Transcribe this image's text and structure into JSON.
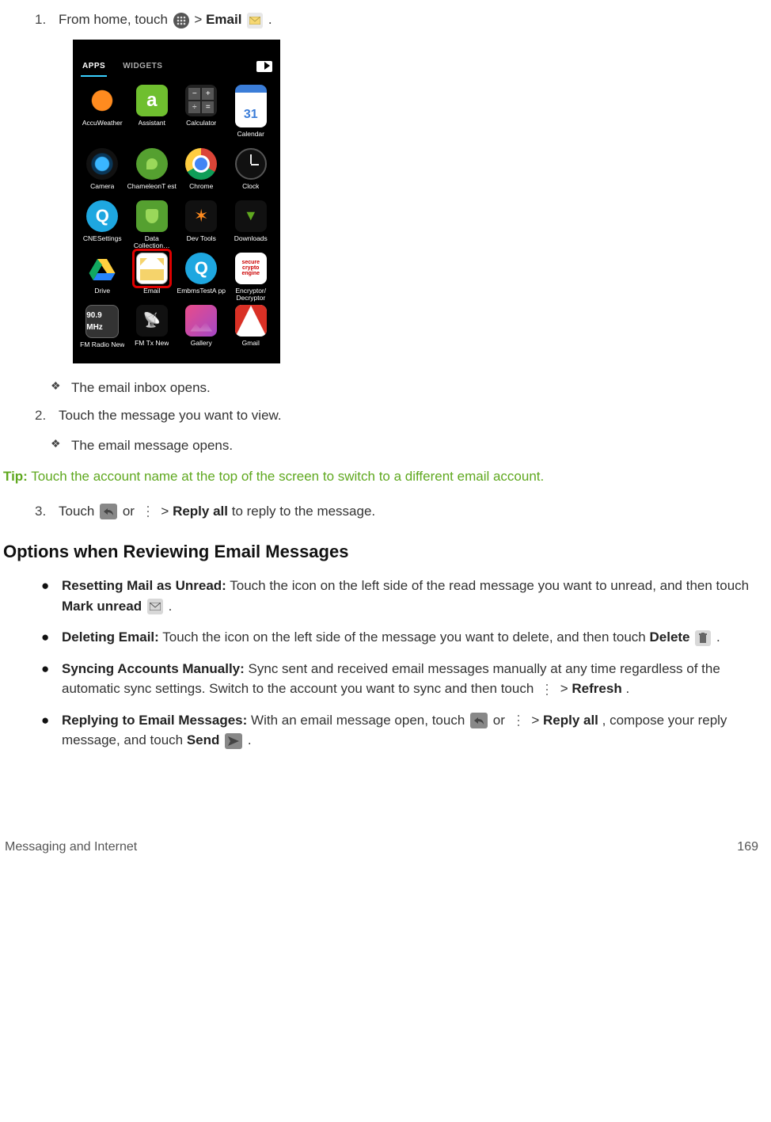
{
  "step1": {
    "num": "1.",
    "t1": "From home, touch ",
    "gt": " > ",
    "email": "Email",
    "period": "."
  },
  "phone": {
    "tabs": {
      "apps": "APPS",
      "widgets": "WIDGETS"
    },
    "apps": [
      "AccuWeather",
      "Assistant",
      "Calculator",
      "Calendar",
      "Camera",
      "ChameleonT est",
      "Chrome",
      "Clock",
      "CNESettings",
      "Data Collection…",
      "Dev Tools",
      "Downloads",
      "Drive",
      "Email",
      "EmbmsTestA pp",
      "Encryptor/ Decryptor",
      "FM Radio New",
      "FM Tx New",
      "Gallery",
      "Gmail"
    ],
    "assist_letter": "a",
    "cal_num": "31",
    "cne_letter": "Q",
    "embms_letter": "Q",
    "fm_label": "90.9 MHz",
    "enc_text": "secure crypto engine"
  },
  "d1": {
    "text": "The email inbox opens."
  },
  "step2": {
    "num": "2.",
    "text": "Touch the message you want to view."
  },
  "d2": {
    "text": "The email message opens."
  },
  "tip": {
    "label": "Tip:",
    "text": " Touch the account name at the top of the screen to switch to a different email account."
  },
  "step3": {
    "num": "3.",
    "t1": "Touch ",
    "or": " or ",
    "gt": " > ",
    "replyall": "Reply all",
    "t2": " to reply to the message."
  },
  "sectionTitle": "Options when Reviewing Email Messages",
  "opt1": {
    "h": "Resetting Mail as Unread:",
    "t1": " Touch the icon on the left side of the read message you want to unread, and then touch ",
    "mark": "Mark unread",
    "period": "."
  },
  "opt2": {
    "h": "Deleting Email:",
    "t1": " Touch the icon on the left side of the message you want to delete, and then touch ",
    "del": "Delete",
    "period": "."
  },
  "opt3": {
    "h": "Syncing Accounts Manually:",
    "t1": " Sync sent and received email messages manually at any time regardless of the automatic sync settings. Switch to the account you want to sync and then touch ",
    "gt": " > ",
    "refresh": "Refresh",
    "period": "."
  },
  "opt4": {
    "h": "Replying to Email Messages:",
    "t1": " With an email message open, touch ",
    "or": " or ",
    "gt": " > ",
    "replyall": "Reply all",
    "t2": ", compose your reply message, and touch ",
    "send": "Send",
    "period": "."
  },
  "footer": {
    "section": "Messaging and Internet",
    "page": "169"
  }
}
